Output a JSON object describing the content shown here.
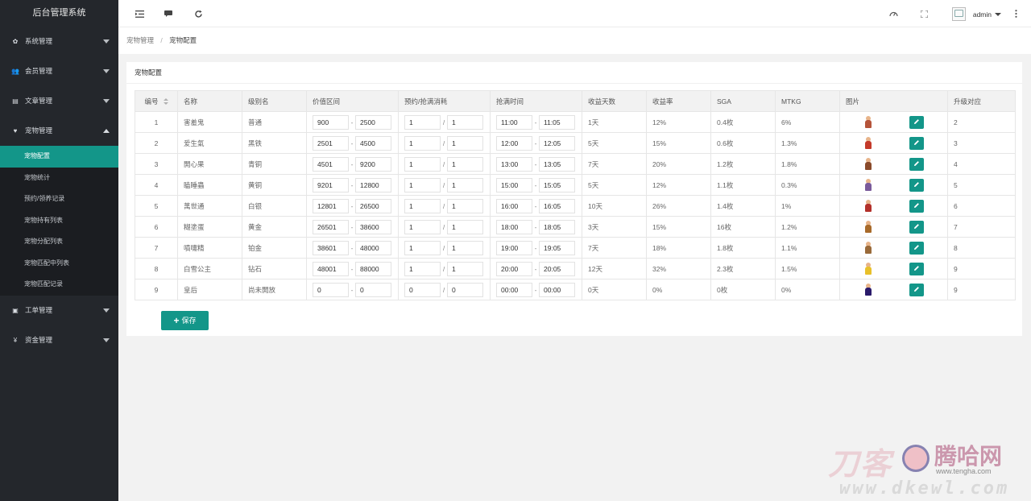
{
  "app": {
    "title": "后台管理系统"
  },
  "sidebar": {
    "items": [
      {
        "label": "系统管理",
        "icon": "gear-icon",
        "glyph": "✿"
      },
      {
        "label": "会员管理",
        "icon": "users-icon",
        "glyph": "👥"
      },
      {
        "label": "文章管理",
        "icon": "article-icon",
        "glyph": "▤"
      },
      {
        "label": "宠物管理",
        "icon": "heart-icon",
        "glyph": "♥",
        "expanded": true
      }
    ],
    "pet_sub": [
      {
        "label": "宠物配置",
        "active": true
      },
      {
        "label": "宠物统计"
      },
      {
        "label": "预约/领养记录"
      },
      {
        "label": "宠物持有列表"
      },
      {
        "label": "宠物分配列表"
      },
      {
        "label": "宠物匹配中列表"
      },
      {
        "label": "宠物匹配记录"
      }
    ],
    "items_after": [
      {
        "label": "工单管理",
        "icon": "ticket-icon",
        "glyph": "▣"
      },
      {
        "label": "资金管理",
        "icon": "yen-icon",
        "glyph": "¥"
      }
    ]
  },
  "header": {
    "icons": [
      "menu-toggle-icon",
      "message-icon",
      "refresh-icon",
      "theme-icon",
      "fullscreen-icon",
      "more-icon"
    ],
    "user": "admin"
  },
  "breadcrumb": {
    "parent": "宠物管理",
    "sep": "/",
    "current": "宠物配置"
  },
  "card": {
    "title": "宠物配置"
  },
  "table": {
    "headers": [
      "编号",
      "名称",
      "级别名",
      "价值区间",
      "预约/抢满消耗",
      "抢满时间",
      "收益天数",
      "收益率",
      "SGA",
      "MTKG",
      "图片",
      "升级对应"
    ],
    "rows": [
      {
        "id": "1",
        "name": "害羞鬼",
        "level": "普通",
        "vmin": "900",
        "vmax": "2500",
        "c1": "1",
        "c2": "1",
        "t1": "11:00",
        "t2": "11:05",
        "days": "1天",
        "rate": "12%",
        "sga": "0.4枚",
        "mtkg": "6%",
        "upgrade": "2",
        "color": "#b5543a"
      },
      {
        "id": "2",
        "name": "爱生氣",
        "level": "黑铁",
        "vmin": "2501",
        "vmax": "4500",
        "c1": "1",
        "c2": "1",
        "t1": "12:00",
        "t2": "12:05",
        "days": "5天",
        "rate": "15%",
        "sga": "0.6枚",
        "mtkg": "1.3%",
        "upgrade": "3",
        "color": "#c43a2a"
      },
      {
        "id": "3",
        "name": "開心果",
        "level": "青铜",
        "vmin": "4501",
        "vmax": "9200",
        "c1": "1",
        "c2": "1",
        "t1": "13:00",
        "t2": "13:05",
        "days": "7天",
        "rate": "20%",
        "sga": "1.2枚",
        "mtkg": "1.8%",
        "upgrade": "4",
        "color": "#8a4a2a"
      },
      {
        "id": "4",
        "name": "瞌睡蟲",
        "level": "黄铜",
        "vmin": "9201",
        "vmax": "12800",
        "c1": "1",
        "c2": "1",
        "t1": "15:00",
        "t2": "15:05",
        "days": "5天",
        "rate": "12%",
        "sga": "1.1枚",
        "mtkg": "0.3%",
        "upgrade": "5",
        "color": "#7a5a9a"
      },
      {
        "id": "5",
        "name": "萬世通",
        "level": "白银",
        "vmin": "12801",
        "vmax": "26500",
        "c1": "1",
        "c2": "1",
        "t1": "16:00",
        "t2": "16:05",
        "days": "10天",
        "rate": "26%",
        "sga": "1.4枚",
        "mtkg": "1%",
        "upgrade": "6",
        "color": "#b3302a"
      },
      {
        "id": "6",
        "name": "糊塗蛋",
        "level": "黄金",
        "vmin": "26501",
        "vmax": "38600",
        "c1": "1",
        "c2": "1",
        "t1": "18:00",
        "t2": "18:05",
        "days": "3天",
        "rate": "15%",
        "sga": "16枚",
        "mtkg": "1.2%",
        "upgrade": "7",
        "color": "#a86a2a"
      },
      {
        "id": "7",
        "name": "噴嚏精",
        "level": "铂金",
        "vmin": "38601",
        "vmax": "48000",
        "c1": "1",
        "c2": "1",
        "t1": "19:00",
        "t2": "19:05",
        "days": "7天",
        "rate": "18%",
        "sga": "1.8枚",
        "mtkg": "1.1%",
        "upgrade": "8",
        "color": "#9a6a3a"
      },
      {
        "id": "8",
        "name": "白雪公主",
        "level": "钻石",
        "vmin": "48001",
        "vmax": "88000",
        "c1": "1",
        "c2": "1",
        "t1": "20:00",
        "t2": "20:05",
        "days": "12天",
        "rate": "32%",
        "sga": "2.3枚",
        "mtkg": "1.5%",
        "upgrade": "9",
        "color": "#e8c02a"
      },
      {
        "id": "9",
        "name": "皇后",
        "level": "尚未開放",
        "vmin": "0",
        "vmax": "0",
        "c1": "0",
        "c2": "0",
        "t1": "00:00",
        "t2": "00:00",
        "days": "0天",
        "rate": "0%",
        "sga": "0枚",
        "mtkg": "0%",
        "upgrade": "9",
        "color": "#2a1a6a"
      }
    ]
  },
  "actions": {
    "save_label": "保存"
  },
  "watermark": {
    "brand": "刀客",
    "site": "腾哈网",
    "url": "www.tengha.com",
    "url2": "www.dkewl.com"
  }
}
